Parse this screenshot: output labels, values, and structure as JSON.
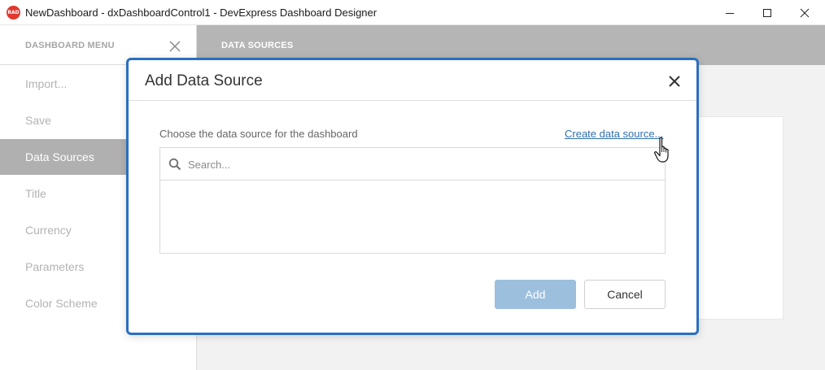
{
  "window": {
    "app_icon_text": "RAD",
    "title": "NewDashboard - dxDashboardControl1 - DevExpress Dashboard Designer"
  },
  "menu": {
    "title": "DASHBOARD MENU",
    "items": [
      {
        "label": "Import..."
      },
      {
        "label": "Save"
      },
      {
        "label": "Data Sources",
        "active": true
      },
      {
        "label": "Title"
      },
      {
        "label": "Currency"
      },
      {
        "label": "Parameters"
      },
      {
        "label": "Color Scheme"
      }
    ]
  },
  "content": {
    "title": "DATA SOURCES"
  },
  "dialog": {
    "title": "Add Data Source",
    "label": "Choose the data source for the dashboard",
    "create_link": "Create data source...",
    "search": {
      "placeholder": "Search...",
      "value": ""
    },
    "add_button": "Add",
    "cancel_button": "Cancel"
  },
  "colors": {
    "accent": "#2a6fc0",
    "link": "#2e6fb0",
    "active_menu": "#b0b0b0",
    "add_button_disabled": "#9dbfde"
  }
}
